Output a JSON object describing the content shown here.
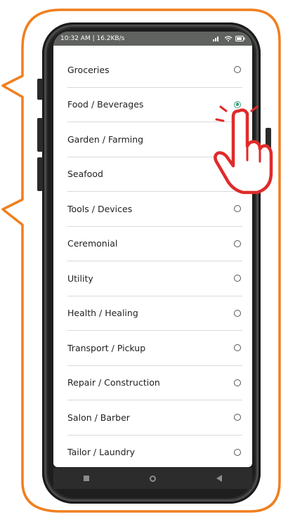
{
  "status_bar": {
    "left_text": "10:32 AM | 16.2KB/s",
    "right_icons": [
      "signal-icon",
      "wifi-icon",
      "battery-icon"
    ]
  },
  "categories": [
    {
      "label": "Groceries",
      "selected": false
    },
    {
      "label": "Food / Beverages",
      "selected": true
    },
    {
      "label": "Garden / Farming",
      "selected": false
    },
    {
      "label": "Seafood",
      "selected": false
    },
    {
      "label": "Tools / Devices",
      "selected": false
    },
    {
      "label": "Ceremonial",
      "selected": false
    },
    {
      "label": "Utility",
      "selected": false
    },
    {
      "label": "Health / Healing",
      "selected": false
    },
    {
      "label": "Transport / Pickup",
      "selected": false
    },
    {
      "label": "Repair / Construction",
      "selected": false
    },
    {
      "label": "Salon / Barber",
      "selected": false
    },
    {
      "label": "Tailor / Laundry",
      "selected": false
    }
  ],
  "nav_bar": {
    "icons": [
      "recents-square-icon",
      "home-circle-icon",
      "back-triangle-icon"
    ]
  },
  "colors": {
    "frame": "#f07f1e",
    "accent": "#3aa17e",
    "status_bar": "#5f625f",
    "pointer_hand": "#e02a2a"
  }
}
